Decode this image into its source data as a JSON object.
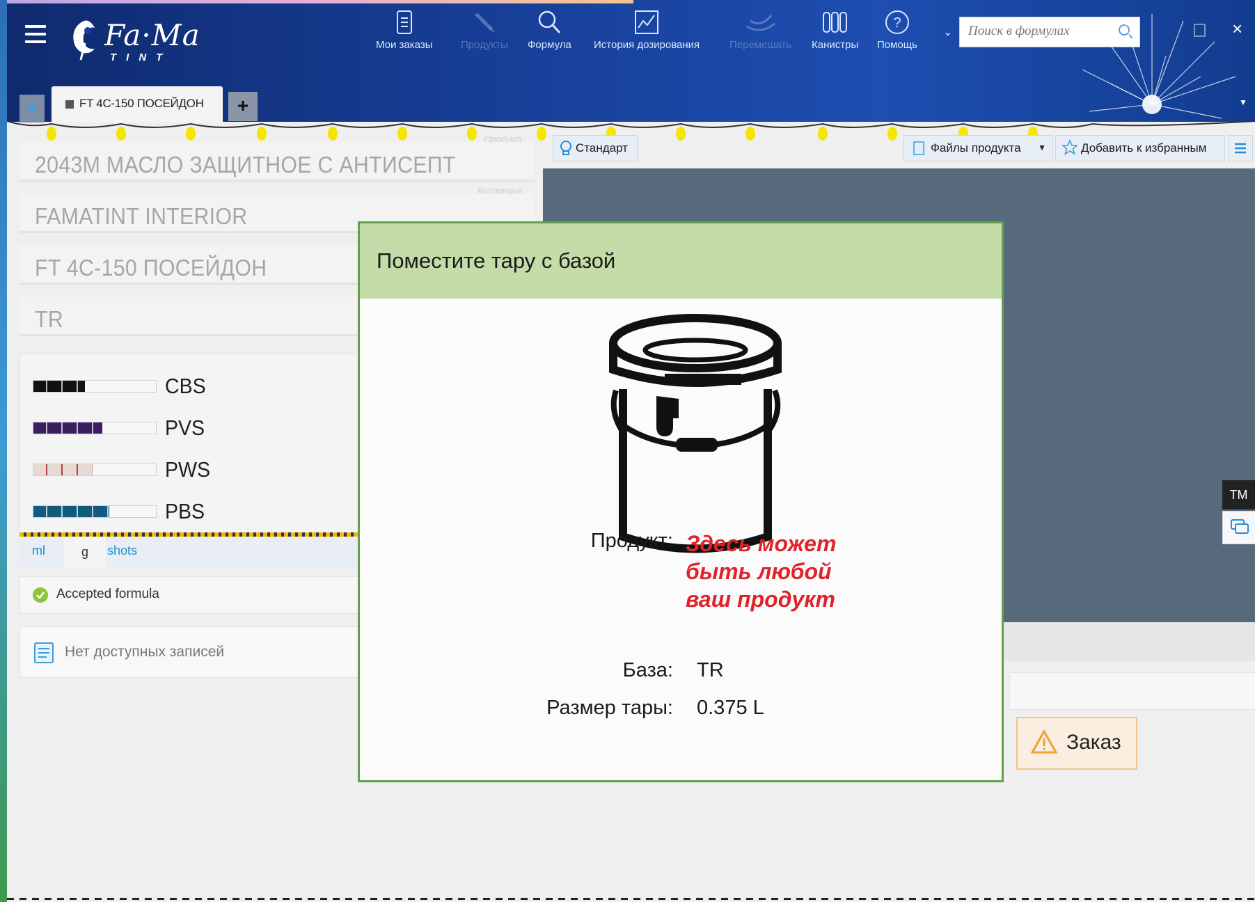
{
  "app": {
    "logo_text": "Fa·Ma",
    "logo_sub": "TINT"
  },
  "nav": {
    "items": [
      {
        "label": "Мои заказы",
        "icon": "document-icon",
        "enabled": true
      },
      {
        "label": "Продукты",
        "icon": "brush-icon",
        "enabled": false
      },
      {
        "label": "Формула",
        "icon": "search-icon",
        "enabled": true
      },
      {
        "label": "История дозирования",
        "icon": "chart-icon",
        "enabled": true
      },
      {
        "label": "Перемешать",
        "icon": "mix-icon",
        "enabled": false
      },
      {
        "label": "Канистры",
        "icon": "canisters-icon",
        "enabled": true
      },
      {
        "label": "Помощь",
        "icon": "help-icon",
        "enabled": true
      }
    ]
  },
  "search": {
    "placeholder": "Поиск в формулах"
  },
  "tabs": {
    "active_label": "FT 4C-150 ПОСЕЙДОН",
    "add_label": "+",
    "star": "★"
  },
  "product": {
    "name": "2043М МАСЛО ЗАЩИТНОЕ С АНТИСЕПТ",
    "name_hint": "Продукт",
    "collection": "FAMATINT INTERIOR",
    "collection_hint": "Коллекция",
    "color": "FT 4C-150 ПОСЕЙДОН",
    "base": "TR"
  },
  "colorants": [
    {
      "name": "CBS",
      "color": "#111111",
      "fill": 0.42
    },
    {
      "name": "PVS",
      "color": "#3a1e5e",
      "fill": 0.56
    },
    {
      "name": "PWS",
      "color": "#e7d9d3",
      "fill": 0.48
    },
    {
      "name": "PBS",
      "color": "#135b7e",
      "fill": 0.62
    }
  ],
  "units": {
    "ml": "ml",
    "g": "g",
    "shots": "shots"
  },
  "status": {
    "accepted": "Accepted formula",
    "no_records": "Нет доступных записей"
  },
  "toolbar": {
    "standard": "Стандарт",
    "files": "Файлы продукта",
    "favorites": "Добавить к избранным"
  },
  "order": {
    "label": "Заказ"
  },
  "side": {
    "tm": "TM"
  },
  "modal": {
    "title": "Поместите тару с базой",
    "product_label": "Продукт:",
    "product_value": "Здесь может быть любой ваш продукт",
    "base_label": "База:",
    "base_value": "TR",
    "size_label": "Размер тары:",
    "size_value": "0.375 L"
  },
  "colors": {
    "header": "#173f98",
    "modal_border": "#64a04a",
    "modal_header": "#c3dca8",
    "preview": "#566a7c",
    "highlight_text": "#e0232a"
  }
}
